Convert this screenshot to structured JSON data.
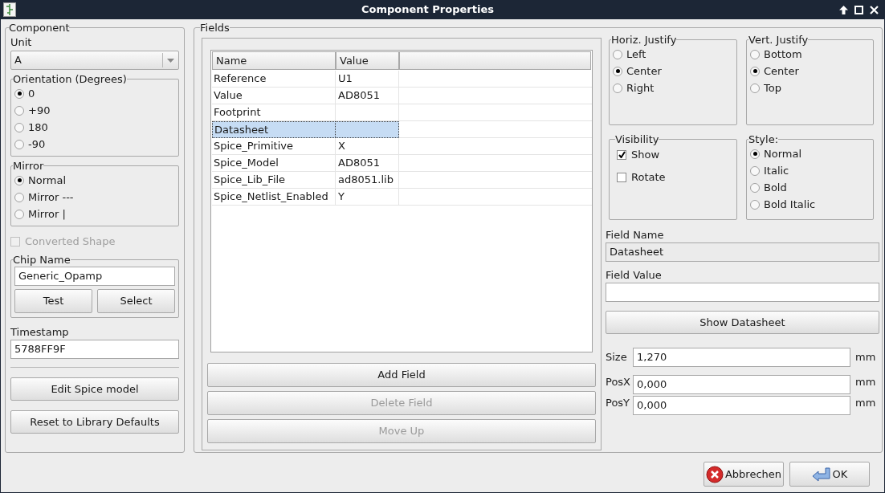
{
  "window": {
    "title": "Component Properties"
  },
  "component": {
    "title": "Component",
    "unit": {
      "label": "Unit",
      "value": "A"
    },
    "orientation": {
      "title": "Orientation (Degrees)",
      "options": [
        {
          "label": "0",
          "selected": true
        },
        {
          "label": "+90",
          "selected": false
        },
        {
          "label": "180",
          "selected": false
        },
        {
          "label": "-90",
          "selected": false
        }
      ]
    },
    "mirror": {
      "title": "Mirror",
      "options": [
        {
          "label": "Normal",
          "selected": true
        },
        {
          "label": "Mirror ---",
          "selected": false
        },
        {
          "label": "Mirror |",
          "selected": false
        }
      ]
    },
    "converted_shape": {
      "label": "Converted Shape",
      "checked": false,
      "disabled": true
    },
    "chip_name": {
      "title": "Chip Name",
      "value": "Generic_Opamp",
      "buttons": [
        "Test",
        "Select"
      ]
    },
    "timestamp": {
      "label": "Timestamp",
      "value": "5788FF9F"
    },
    "buttons": [
      "Edit Spice model",
      "Reset to Library Defaults"
    ]
  },
  "fields": {
    "title": "Fields",
    "table": {
      "columns": [
        "Name",
        "Value"
      ],
      "rows": [
        {
          "name": "Reference",
          "value": "U1",
          "selected": false
        },
        {
          "name": "Value",
          "value": "AD8051",
          "selected": false
        },
        {
          "name": "Footprint",
          "selected": false
        },
        {
          "name": "Datasheet",
          "selected": true
        },
        {
          "name": "Spice_Primitive",
          "value": "X",
          "selected": false
        },
        {
          "name": "Spice_Model",
          "value": "AD8051",
          "selected": false
        },
        {
          "name": "Spice_Lib_File",
          "value": "ad8051.lib",
          "selected": false
        },
        {
          "name": "Spice_Netlist_Enabled",
          "value": "Y",
          "selected": false
        }
      ]
    },
    "buttons": [
      {
        "label": "Add Field",
        "disabled": false
      },
      {
        "label": "Delete Field",
        "disabled": true
      },
      {
        "label": "Move Up",
        "disabled": true
      }
    ],
    "horiz_justify": {
      "title": "Horiz. Justify",
      "options": [
        {
          "label": "Left",
          "selected": false
        },
        {
          "label": "Center",
          "selected": true
        },
        {
          "label": "Right",
          "selected": false
        }
      ]
    },
    "vert_justify": {
      "title": "Vert. Justify",
      "options": [
        {
          "label": "Bottom",
          "selected": false
        },
        {
          "label": "Center",
          "selected": true
        },
        {
          "label": "Top",
          "selected": false
        }
      ]
    },
    "visibility": {
      "title": "Visibility",
      "options": [
        {
          "label": "Show",
          "checked": true
        },
        {
          "label": "Rotate",
          "checked": false
        }
      ]
    },
    "style": {
      "title": "Style:",
      "options": [
        {
          "label": "Normal",
          "selected": true
        },
        {
          "label": "Italic",
          "selected": false
        },
        {
          "label": "Bold",
          "selected": false
        },
        {
          "label": "Bold Italic",
          "selected": false
        }
      ]
    },
    "field_name": {
      "label": "Field Name",
      "value": "Datasheet",
      "readonly": true
    },
    "field_value": {
      "label": "Field Value"
    },
    "show_datasheet": "Show Datasheet",
    "params": [
      {
        "label": "Size",
        "value": "1,270",
        "unit": "mm"
      },
      {
        "label": "PosX",
        "value": "0,000",
        "unit": "mm"
      },
      {
        "label": "PosY",
        "value": "0,000",
        "unit": "mm"
      }
    ]
  },
  "dialog_buttons": [
    {
      "label": "Abbrechen",
      "kind": "cancel"
    },
    {
      "label": "OK",
      "kind": "ok"
    }
  ]
}
